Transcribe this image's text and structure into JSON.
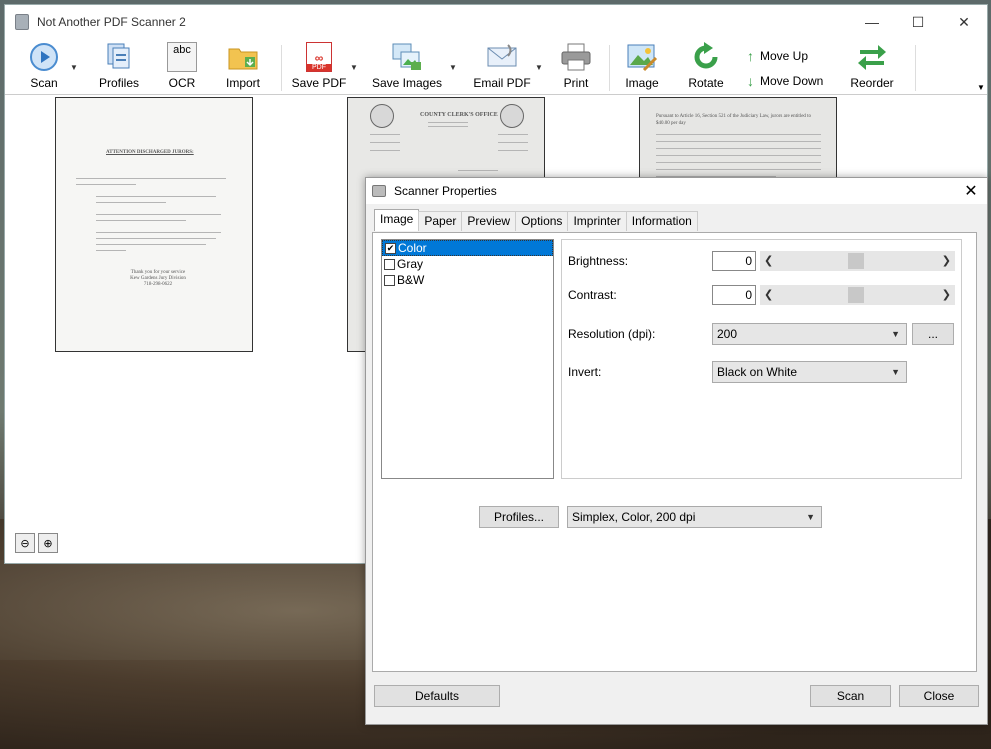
{
  "app": {
    "title": "Not Another PDF Scanner 2",
    "toolbar": {
      "scan": "Scan",
      "profiles": "Profiles",
      "ocr": "OCR",
      "ocr_icon_text": "abc",
      "import": "Import",
      "save_pdf": "Save PDF",
      "save_pdf_icon_text": "PDF",
      "save_images": "Save Images",
      "email_pdf": "Email PDF",
      "print": "Print",
      "image": "Image",
      "rotate": "Rotate",
      "move_up": "Move Up",
      "move_down": "Move Down",
      "reorder": "Reorder"
    },
    "thumbnails": [
      {
        "heading": "ATTENTION DISCHARGED JURORS:",
        "footer": "Thank you for your service\nKew Gardens Jury Division\n718-298-0622"
      },
      {
        "heading": "COUNTY CLERK'S OFFICE"
      },
      {
        "heading": "Pursuant to Article 16, Section 521 of the Judiciary Law, jurors are entitled to $40.00 per day"
      }
    ]
  },
  "dialog": {
    "title": "Scanner Properties",
    "tabs": [
      "Image",
      "Paper",
      "Preview",
      "Options",
      "Imprinter",
      "Information"
    ],
    "modes": [
      {
        "label": "Color",
        "checked": true
      },
      {
        "label": "Gray",
        "checked": false
      },
      {
        "label": "B&W",
        "checked": false
      }
    ],
    "brightness_label": "Brightness:",
    "brightness_value": "0",
    "contrast_label": "Contrast:",
    "contrast_value": "0",
    "resolution_label": "Resolution (dpi):",
    "resolution_value": "200",
    "more_button": "...",
    "invert_label": "Invert:",
    "invert_value": "Black on White",
    "profiles_button": "Profiles...",
    "profile_value": "Simplex, Color, 200 dpi",
    "defaults_button": "Defaults",
    "scan_button": "Scan",
    "close_button": "Close"
  },
  "colors": {
    "selection": "#0078d7",
    "pdf_red": "#d9342b",
    "green_icon": "#3aa04a"
  }
}
